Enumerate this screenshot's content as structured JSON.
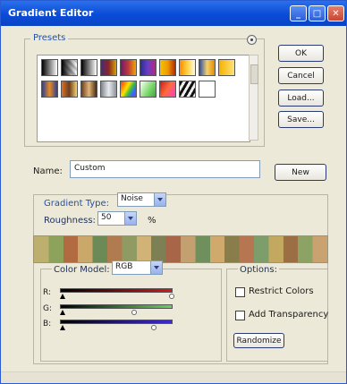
{
  "window": {
    "title": "Gradient Editor"
  },
  "presets": {
    "legend": "Presets",
    "swatches": [
      [
        "#000000",
        "#ffffff",
        "#9a9a9a",
        "#3a3a3a",
        "#ab2b2b",
        "#5d2ea8",
        "#d6b800",
        "#f1a200",
        "#ffcc00",
        "#f6e3a0"
      ],
      [
        "#2b4ab4",
        "#e87e2b",
        "#9b6f3e",
        "#cfd2d6",
        "#ff3b3b",
        "#76c85c",
        "#f2f2f2",
        "#3f3f3f",
        "#ffffff"
      ]
    ]
  },
  "buttons": {
    "ok": "OK",
    "cancel": "Cancel",
    "load": "Load...",
    "save": "Save...",
    "new": "New"
  },
  "name": {
    "label": "Name:",
    "value": "Custom"
  },
  "gradient_type": {
    "label": "Gradient Type:",
    "value": "Noise"
  },
  "roughness": {
    "label": "Roughness:",
    "value": "50",
    "unit": "%"
  },
  "color_model": {
    "label": "Color Model:",
    "value": "RGB"
  },
  "channels": {
    "r": "R:",
    "g": "G:",
    "b": "B:"
  },
  "options": {
    "legend": "Options:",
    "restrict_colors": "Restrict Colors",
    "add_transparency": "Add Transparency",
    "randomize": "Randomize"
  },
  "gradient": {
    "colors": [
      "#bdb06f",
      "#8da25b",
      "#b26a40",
      "#c9a86a",
      "#6c8a56",
      "#b07c4f",
      "#8f9b62",
      "#d1b378",
      "#7d8055",
      "#a86547",
      "#c4a070",
      "#6f8f5c",
      "#d0aa6d",
      "#8a7d4c",
      "#b57651",
      "#7d9e6a",
      "#c3a95f",
      "#9c6e44",
      "#8ca365",
      "#caa26f"
    ]
  },
  "colors": {
    "title_bar": "#0a4bd8",
    "accent": "#2450a6"
  }
}
